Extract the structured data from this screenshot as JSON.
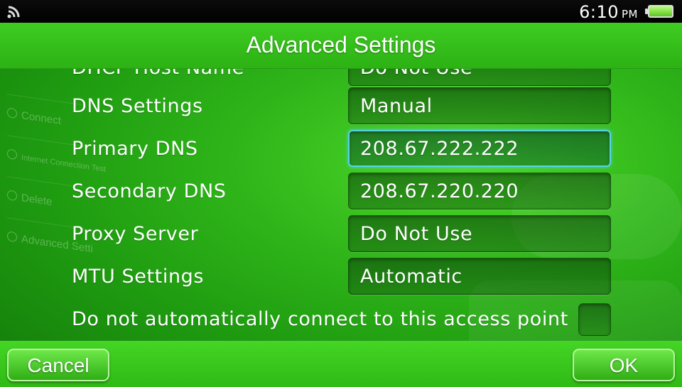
{
  "status_bar": {
    "time": "6:10",
    "ampm": "PM",
    "wifi_icon": "wifi-signal-icon",
    "battery_icon": "battery-full-icon"
  },
  "header": {
    "title": "Advanced Settings"
  },
  "background_menu": {
    "items": [
      "Connect",
      "Internet Connection Test",
      "Delete",
      "Advanced Setti"
    ]
  },
  "settings": {
    "rows": [
      {
        "label": "DHCP Host Name",
        "value": "Do Not Use"
      },
      {
        "label": "DNS Settings",
        "value": "Manual"
      },
      {
        "label": "Primary DNS",
        "value": "208.67.222.222"
      },
      {
        "label": "Secondary DNS",
        "value": "208.67.220.220"
      },
      {
        "label": "Proxy Server",
        "value": "Do Not Use"
      },
      {
        "label": "MTU Settings",
        "value": "Automatic"
      }
    ],
    "auto_connect_label": "Do not automatically connect to this access point"
  },
  "footer": {
    "cancel_label": "Cancel",
    "ok_label": "OK"
  },
  "colors": {
    "accent": "#2fb519",
    "selection": "#56d4e8"
  }
}
